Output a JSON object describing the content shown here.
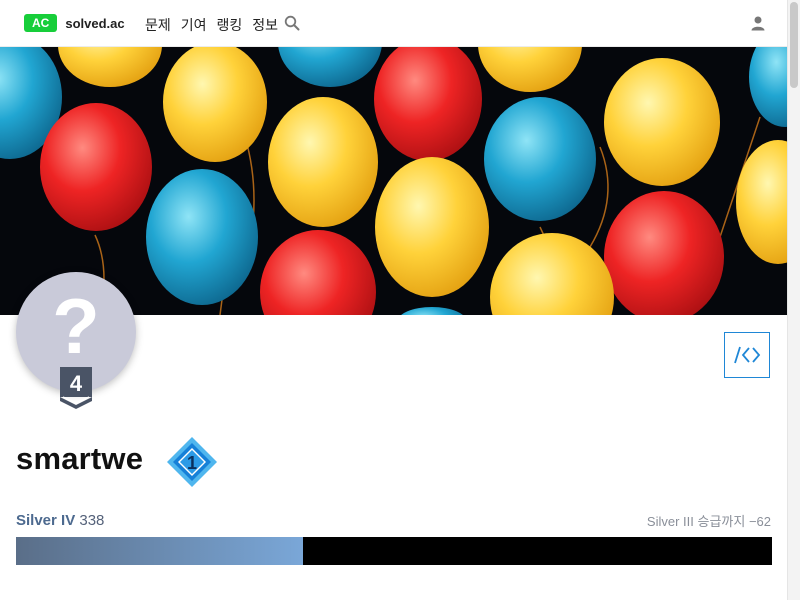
{
  "header": {
    "brand_badge": "AC",
    "brand_name": "solved.ac",
    "nav": [
      "문제",
      "기여",
      "랭킹",
      "정보"
    ]
  },
  "profile": {
    "avatar_symbol": "?",
    "class_level": "4",
    "username": "smartwe",
    "rank_badge": "1",
    "tier_name": "Silver IV",
    "rating": "338",
    "next_tier": "Silver III 승급까지 −62",
    "progress_fraction": 0.38
  },
  "colors": {
    "brand": "#17ce3a",
    "silver": "#4d6a8f",
    "rank_badge": "#1aa0f0"
  },
  "icons": [
    "search-icon",
    "user-icon",
    "code-icon",
    "question-icon",
    "chevron-icon"
  ]
}
